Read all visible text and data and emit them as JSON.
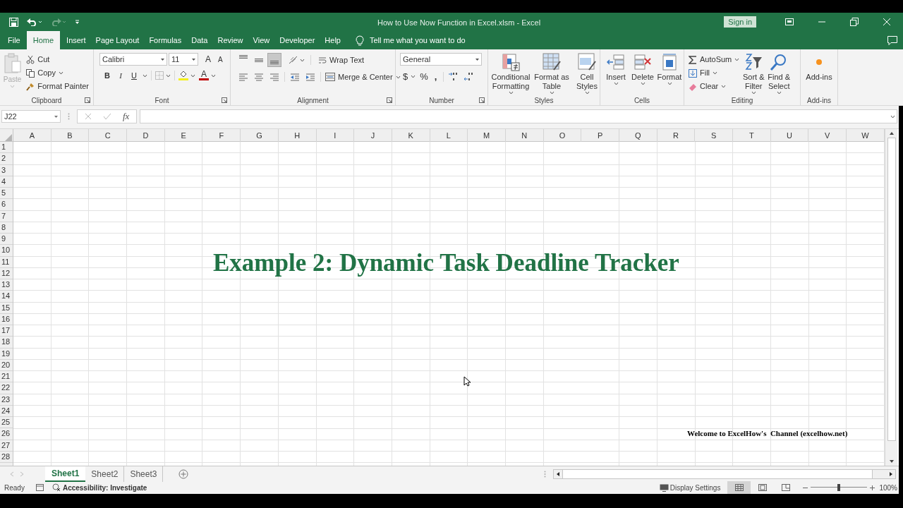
{
  "title_bar": {
    "title": "How to Use Now Function in Excel.xlsm - Excel",
    "sign_in": "Sign in"
  },
  "tabs": [
    {
      "label": "File",
      "selected": false
    },
    {
      "label": "Home",
      "selected": true
    },
    {
      "label": "Insert",
      "selected": false
    },
    {
      "label": "Page Layout",
      "selected": false
    },
    {
      "label": "Formulas",
      "selected": false
    },
    {
      "label": "Data",
      "selected": false
    },
    {
      "label": "Review",
      "selected": false
    },
    {
      "label": "View",
      "selected": false
    },
    {
      "label": "Developer",
      "selected": false
    },
    {
      "label": "Help",
      "selected": false
    }
  ],
  "tell_me": "Tell me what you want to do",
  "clipboard": {
    "label": "Clipboard",
    "paste": {
      "label": "Paste",
      "disabled": true
    },
    "items": [
      "Cut",
      "Copy",
      "Format Painter"
    ]
  },
  "font": {
    "label": "Font",
    "font_name": "Calibri",
    "font_size": "11",
    "grow": "A",
    "shrink": "A",
    "bold": "B",
    "italic": "I",
    "underline": "U",
    "font_color": "A"
  },
  "alignment": {
    "label": "Alignment",
    "vertical": [
      {
        "selected": false
      },
      {
        "selected": false
      },
      {
        "selected": true
      }
    ],
    "wrap_text": "Wrap Text",
    "merge": "Merge & Center"
  },
  "number": {
    "label": "Number",
    "format": "General",
    "currency": "$",
    "percent": "%",
    "comma": ","
  },
  "styles": {
    "label": "Styles",
    "buttons": [
      "Conditional Formatting",
      "Format as Table",
      "Cell Styles"
    ]
  },
  "cells_group": {
    "label": "Cells",
    "buttons": [
      "Insert",
      "Delete",
      "Format"
    ]
  },
  "editing": {
    "label": "Editing",
    "items": [
      "AutoSum",
      "Fill",
      "Clear"
    ],
    "buttons": [
      "Sort & Filter",
      "Find & Select"
    ]
  },
  "addins": {
    "label": "Add-ins",
    "button": "Add-ins"
  },
  "formula_bar": {
    "name_box": "J22",
    "function_symbol": "fx"
  },
  "columns": [
    "A",
    "B",
    "C",
    "D",
    "E",
    "F",
    "G",
    "H",
    "I",
    "J",
    "K",
    "L",
    "M",
    "N",
    "O",
    "P",
    "Q",
    "R",
    "S",
    "T",
    "U",
    "V",
    "W"
  ],
  "rows": [
    "1",
    "2",
    "3",
    "4",
    "5",
    "6",
    "7",
    "8",
    "9",
    "10",
    "11",
    "12",
    "13",
    "14",
    "15",
    "16",
    "17",
    "18",
    "19",
    "20",
    "21",
    "22",
    "23",
    "24",
    "25",
    "26",
    "27",
    "28"
  ],
  "sheet_texts": [
    {
      "kind": "title",
      "text": "Example 2: Dynamic Task Deadline Tracker"
    },
    {
      "kind": "note",
      "text": "Welcome to ExcelHow's  Channel (excelhow.net)"
    }
  ],
  "sheet_tabs": [
    {
      "label": "Sheet1",
      "selected": true
    },
    {
      "label": "Sheet2",
      "selected": false
    },
    {
      "label": "Sheet3",
      "selected": false
    }
  ],
  "status_bar": {
    "mode": "Ready",
    "accessibility": "Accessibility: Investigate",
    "display_settings": "Display Settings",
    "view_buttons": [
      {
        "selected": true
      },
      {
        "selected": false
      },
      {
        "selected": false
      }
    ],
    "zoom": {
      "level": 0.5,
      "reading": "100%"
    }
  }
}
